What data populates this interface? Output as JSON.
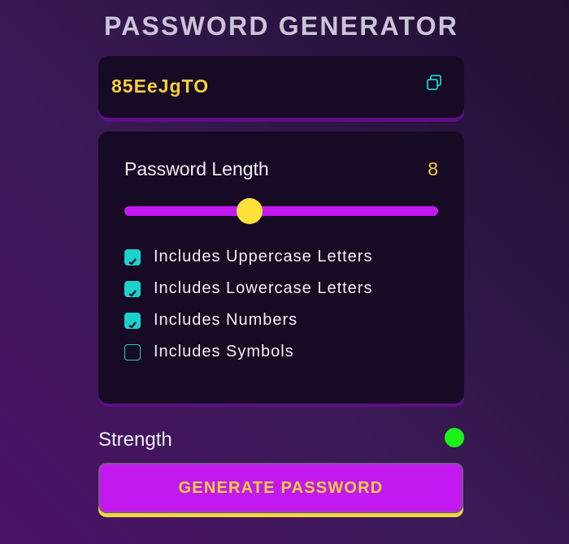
{
  "app": {
    "title": "PASSWORD GENERATOR"
  },
  "output": {
    "password": "85EeJgTO",
    "copy_icon": "copy-icon"
  },
  "settings": {
    "length_label": "Password Length",
    "length_value": "8",
    "slider": {
      "min": 0,
      "max": 20,
      "value": 8
    },
    "options": [
      {
        "label": "Includes Uppercase Letters",
        "checked": true
      },
      {
        "label": "Includes Lowercase Letters",
        "checked": true
      },
      {
        "label": "Includes Numbers",
        "checked": true
      },
      {
        "label": "Includes Symbols",
        "checked": false
      }
    ]
  },
  "strength": {
    "label": "Strength",
    "indicator_color": "#1cf11c"
  },
  "generate_button": {
    "label": "GENERATE PASSWORD"
  },
  "colors": {
    "accent": "#c219f0",
    "password_text": "#f6d13a",
    "checkbox": "#1ad1cc",
    "panel_bg": "#170a24"
  }
}
